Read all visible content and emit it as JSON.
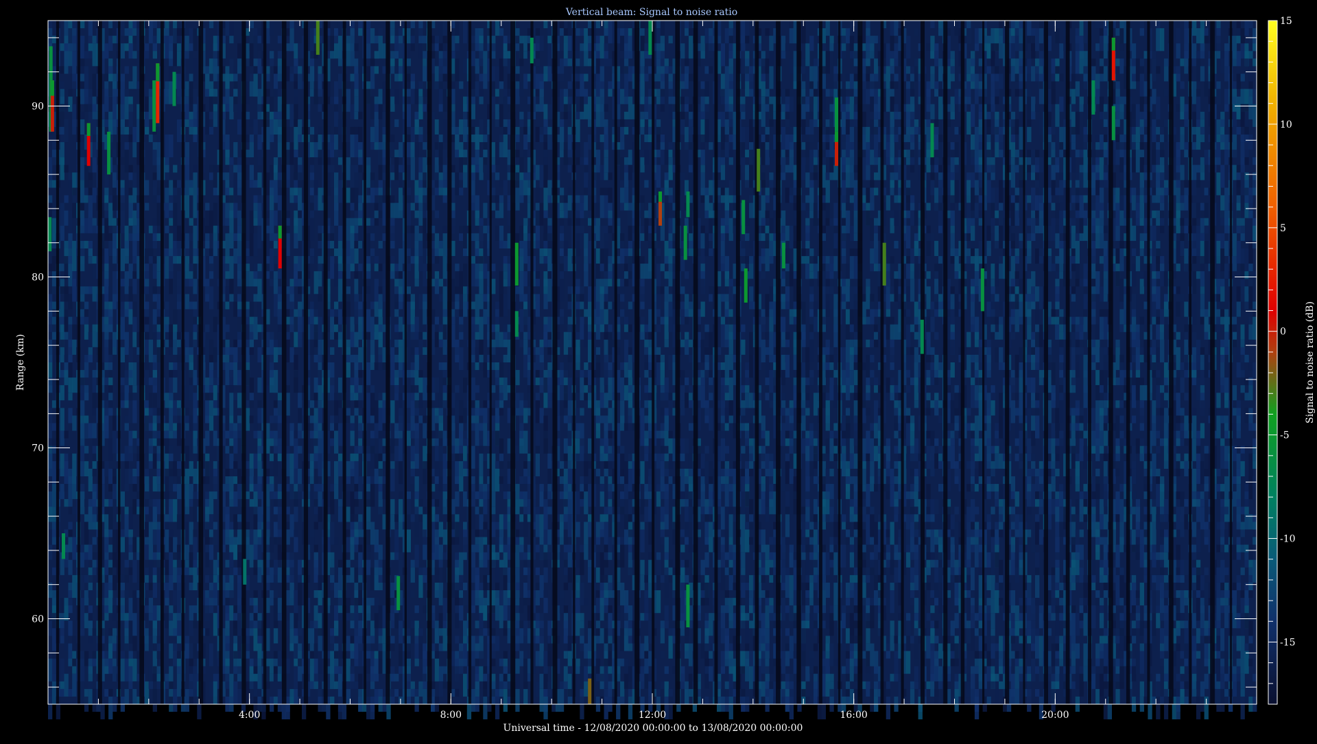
{
  "chart_data": {
    "type": "heatmap",
    "title": "Vertical beam: Signal to noise ratio",
    "xlabel": "Universal time - 12/08/2020 00:00:00 to 13/08/2020 00:00:00",
    "ylabel": "Range (km)",
    "x_unit": "hours UT",
    "xlim": [
      0,
      24
    ],
    "ylim": [
      55,
      95
    ],
    "x_ticks": [
      {
        "value": 4,
        "label": "4:00"
      },
      {
        "value": 8,
        "label": "8:00"
      },
      {
        "value": 12,
        "label": "12:00"
      },
      {
        "value": 16,
        "label": "16:00"
      },
      {
        "value": 20,
        "label": "20:00"
      }
    ],
    "y_ticks": [
      {
        "value": 60,
        "label": "60"
      },
      {
        "value": 70,
        "label": "70"
      },
      {
        "value": 80,
        "label": "80"
      },
      {
        "value": 90,
        "label": "90"
      }
    ],
    "colorbar": {
      "label": "Signal to noise ratio (dB)",
      "range": [
        -18,
        15
      ],
      "ticks": [
        {
          "value": 15,
          "label": "15"
        },
        {
          "value": 10,
          "label": "10"
        },
        {
          "value": 5,
          "label": "5"
        },
        {
          "value": 0,
          "label": "0"
        },
        {
          "value": -5,
          "label": "-5"
        },
        {
          "value": -10,
          "label": "-10"
        },
        {
          "value": -15,
          "label": "-15"
        }
      ],
      "colors": [
        {
          "value": -18,
          "color": "#0a1030"
        },
        {
          "value": -14,
          "color": "#10306a"
        },
        {
          "value": -11,
          "color": "#0a5a78"
        },
        {
          "value": -8,
          "color": "#008060"
        },
        {
          "value": -4,
          "color": "#10a020"
        },
        {
          "value": -1,
          "color": "#b04010"
        },
        {
          "value": 1,
          "color": "#e00000"
        },
        {
          "value": 6,
          "color": "#f06000"
        },
        {
          "value": 11,
          "color": "#f0b000"
        },
        {
          "value": 15,
          "color": "#ffff20"
        }
      ]
    },
    "background_snr_db": -16,
    "echoes": [
      {
        "t": 0.05,
        "r0": 88.5,
        "r1": 93.5,
        "snr": -6
      },
      {
        "t": 0.08,
        "r0": 88.5,
        "r1": 91.5,
        "snr": 0
      },
      {
        "t": 0.03,
        "r0": 81.5,
        "r1": 83.5,
        "snr": -7
      },
      {
        "t": 0.3,
        "r0": 63.5,
        "r1": 65.0,
        "snr": -7
      },
      {
        "t": 0.8,
        "r0": 86.5,
        "r1": 89.0,
        "snr": 1
      },
      {
        "t": 1.2,
        "r0": 86.0,
        "r1": 88.5,
        "snr": -6
      },
      {
        "t": 2.1,
        "r0": 88.5,
        "r1": 91.5,
        "snr": -6
      },
      {
        "t": 2.17,
        "r0": 89.0,
        "r1": 92.5,
        "snr": 3
      },
      {
        "t": 2.5,
        "r0": 90.0,
        "r1": 92.0,
        "snr": -7
      },
      {
        "t": 3.9,
        "r0": 62.0,
        "r1": 63.5,
        "snr": -9
      },
      {
        "t": 4.6,
        "r0": 80.5,
        "r1": 83.0,
        "snr": 1
      },
      {
        "t": 5.35,
        "r0": 93.0,
        "r1": 95.0,
        "snr": -3
      },
      {
        "t": 6.95,
        "r0": 60.5,
        "r1": 62.5,
        "snr": -6
      },
      {
        "t": 9.3,
        "r0": 79.5,
        "r1": 82.0,
        "snr": -5
      },
      {
        "t": 9.3,
        "r0": 76.5,
        "r1": 78.0,
        "snr": -7
      },
      {
        "t": 9.6,
        "r0": 92.5,
        "r1": 94.0,
        "snr": -7
      },
      {
        "t": 10.75,
        "r0": 55.0,
        "r1": 56.5,
        "snr": -2
      },
      {
        "t": 11.95,
        "r0": 93.0,
        "r1": 95.0,
        "snr": -7
      },
      {
        "t": 12.15,
        "r0": 83.0,
        "r1": 85.0,
        "snr": -1
      },
      {
        "t": 12.65,
        "r0": 81.0,
        "r1": 83.0,
        "snr": -6
      },
      {
        "t": 12.7,
        "r0": 83.5,
        "r1": 85.0,
        "snr": -7
      },
      {
        "t": 12.7,
        "r0": 59.5,
        "r1": 62.0,
        "snr": -6
      },
      {
        "t": 13.8,
        "r0": 82.5,
        "r1": 84.5,
        "snr": -6
      },
      {
        "t": 13.85,
        "r0": 78.5,
        "r1": 80.5,
        "snr": -5
      },
      {
        "t": 14.1,
        "r0": 85.0,
        "r1": 87.5,
        "snr": -3
      },
      {
        "t": 14.6,
        "r0": 80.5,
        "r1": 82.0,
        "snr": -6
      },
      {
        "t": 15.65,
        "r0": 86.5,
        "r1": 88.5,
        "snr": 0
      },
      {
        "t": 15.65,
        "r0": 88.5,
        "r1": 90.5,
        "snr": -6
      },
      {
        "t": 16.6,
        "r0": 79.5,
        "r1": 82.0,
        "snr": -3
      },
      {
        "t": 17.35,
        "r0": 75.5,
        "r1": 77.5,
        "snr": -7
      },
      {
        "t": 17.55,
        "r0": 87.0,
        "r1": 89.0,
        "snr": -7
      },
      {
        "t": 18.55,
        "r0": 78.0,
        "r1": 80.5,
        "snr": -6
      },
      {
        "t": 20.75,
        "r0": 89.5,
        "r1": 91.5,
        "snr": -7
      },
      {
        "t": 21.15,
        "r0": 91.5,
        "r1": 94.0,
        "snr": 2
      },
      {
        "t": 21.15,
        "r0": 88.0,
        "r1": 90.0,
        "snr": -6
      }
    ]
  }
}
